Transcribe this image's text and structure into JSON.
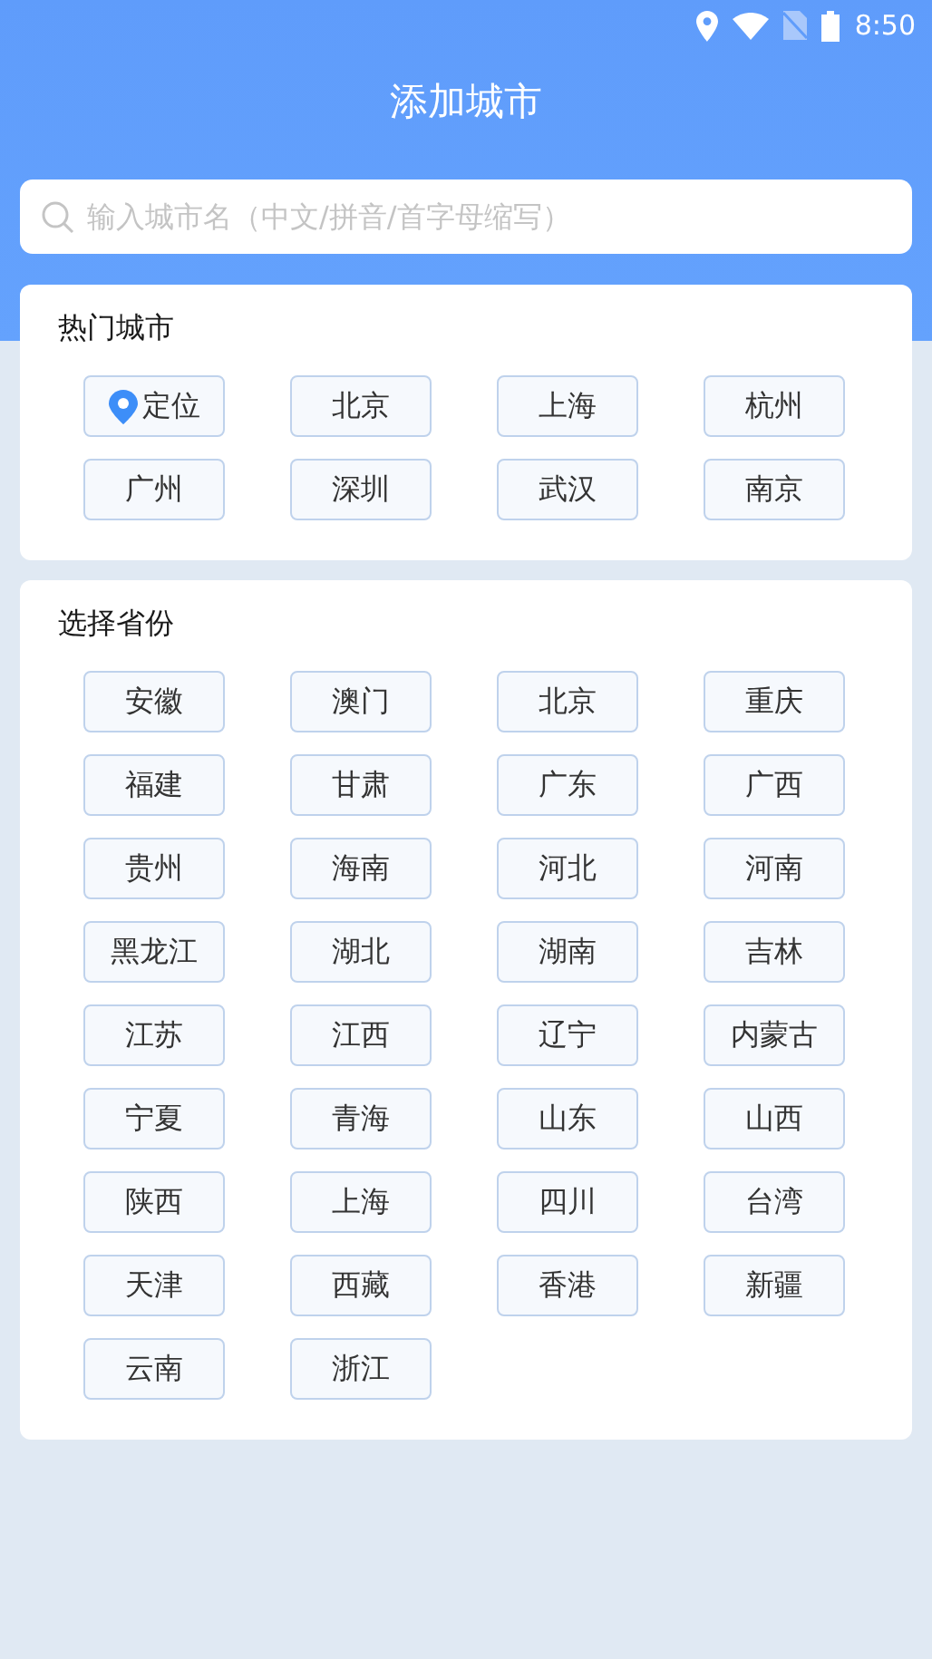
{
  "status_bar": {
    "time": "8:50"
  },
  "title": "添加城市",
  "search": {
    "placeholder": "输入城市名（中文/拼音/首字母缩写）"
  },
  "hot_cities": {
    "heading": "热门城市",
    "items": [
      {
        "label": "定位",
        "kind": "location"
      },
      {
        "label": "北京",
        "kind": "city"
      },
      {
        "label": "上海",
        "kind": "city"
      },
      {
        "label": "杭州",
        "kind": "city"
      },
      {
        "label": "广州",
        "kind": "city"
      },
      {
        "label": "深圳",
        "kind": "city"
      },
      {
        "label": "武汉",
        "kind": "city"
      },
      {
        "label": "南京",
        "kind": "city"
      }
    ]
  },
  "provinces": {
    "heading": "选择省份",
    "items": [
      "安徽",
      "澳门",
      "北京",
      "重庆",
      "福建",
      "甘肃",
      "广东",
      "广西",
      "贵州",
      "海南",
      "河北",
      "河南",
      "黑龙江",
      "湖北",
      "湖南",
      "吉林",
      "江苏",
      "江西",
      "辽宁",
      "内蒙古",
      "宁夏",
      "青海",
      "山东",
      "山西",
      "陕西",
      "上海",
      "四川",
      "台湾",
      "天津",
      "西藏",
      "香港",
      "新疆",
      "云南",
      "浙江"
    ]
  }
}
